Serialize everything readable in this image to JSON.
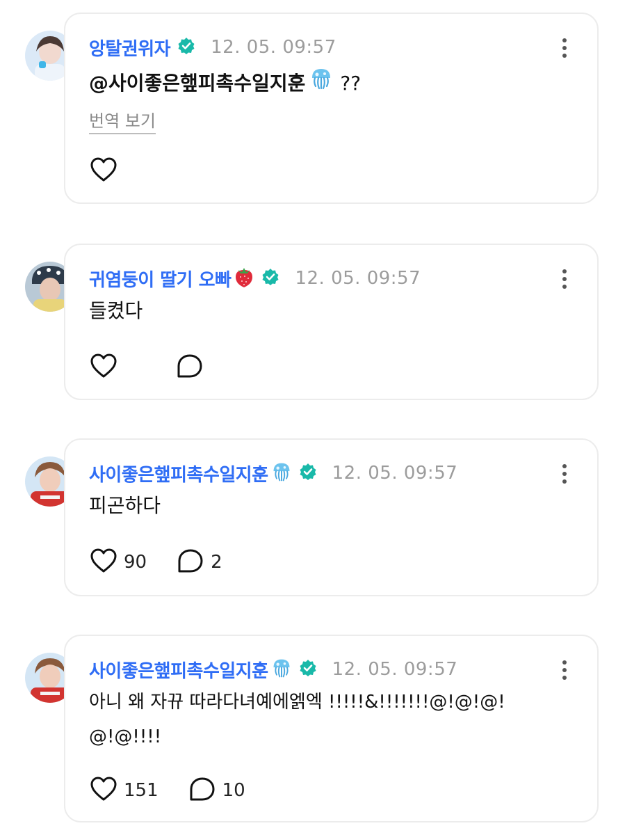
{
  "comments": [
    {
      "author": "앙탈권위자",
      "author_emoji": "",
      "time": "12. 05. 09:57",
      "text_parts": [
        "@사이좋은햎피촉수일지훈",
        "??"
      ],
      "translate_label": "번역 보기",
      "likes": "",
      "replies": "",
      "show_reply": false,
      "avatar_colors": [
        "#d9e8f6",
        "#5a4a44"
      ]
    },
    {
      "author": "귀염둥이 딸기 오빠",
      "author_emoji": "strawberry-emoji",
      "time": "12. 05. 09:57",
      "text": "들켰다",
      "likes": "",
      "replies": "",
      "show_reply": true,
      "avatar_colors": [
        "#a7b8c7",
        "#3b2e2a"
      ]
    },
    {
      "author": "사이좋은햎피촉수일지훈",
      "author_emoji": "jellyfish-emoji",
      "time": "12. 05. 09:57",
      "text": "피곤하다",
      "likes": "90",
      "replies": "2",
      "show_reply": true,
      "avatar_colors": [
        "#cfe3f4",
        "#c8312e"
      ]
    },
    {
      "author": "사이좋은햎피촉수일지훈",
      "author_emoji": "jellyfish-emoji",
      "time": "12. 05. 09:57",
      "text_line1": "아니 왜 자뀨 따라다녀예에엙엑 !!!!!&!!!!!!!@!@!@!",
      "text_line2": "@!@!!!!",
      "likes": "151",
      "replies": "10",
      "show_reply": true,
      "avatar_colors": [
        "#cfe3f4",
        "#c8312e"
      ]
    }
  ],
  "colors": {
    "author": "#2f6df5",
    "verified": "#19b9a9",
    "time": "#9c9c9c",
    "card_border": "#ececec"
  }
}
